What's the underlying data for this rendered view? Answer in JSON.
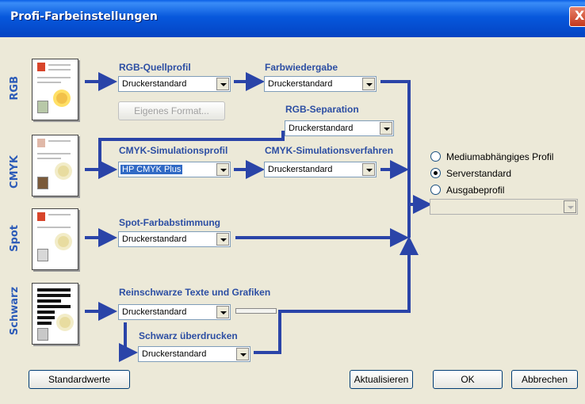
{
  "window": {
    "title": "Profi-Farbeinstellungen",
    "close_glyph": "X"
  },
  "rows": {
    "rgb": "RGB",
    "cmyk": "CMYK",
    "spot": "Spot",
    "schwarz": "Schwarz"
  },
  "headings": {
    "rgb_source": "RGB-Quellprofil",
    "rendering": "Farbwiedergabe",
    "rgb_separation": "RGB-Separation",
    "cmyk_sim_profile": "CMYK-Simulationsprofil",
    "cmyk_sim_method": "CMYK-Simulationsverfahren",
    "spot_match": "Spot-Farbabstimmung",
    "pure_black": "Reinschwarze Texte und Grafiken",
    "black_overprint": "Schwarz überdrucken"
  },
  "combos": {
    "rgb_source": "Druckerstandard",
    "rendering": "Druckerstandard",
    "rgb_separation": "Druckerstandard",
    "cmyk_sim_profile": "HP CMYK Plus",
    "cmyk_sim_method": "Druckerstandard",
    "spot_match": "Druckerstandard",
    "pure_black": "Druckerstandard",
    "black_overprint": "Druckerstandard"
  },
  "buttons": {
    "custom_format": "Eigenes Format...",
    "defaults": "Standardwerte",
    "refresh": "Aktualisieren",
    "ok": "OK",
    "cancel": "Abbrechen"
  },
  "output_options": {
    "media_independent": "Mediumabhängiges Profil",
    "server_default": "Serverstandard",
    "output_profile": "Ausgabeprofil",
    "selected": "server_default",
    "output_profile_value": ""
  },
  "colors": {
    "arrow": "#2a44a8",
    "heading": "#2c4ea3",
    "titlebar": "#0758dc"
  }
}
